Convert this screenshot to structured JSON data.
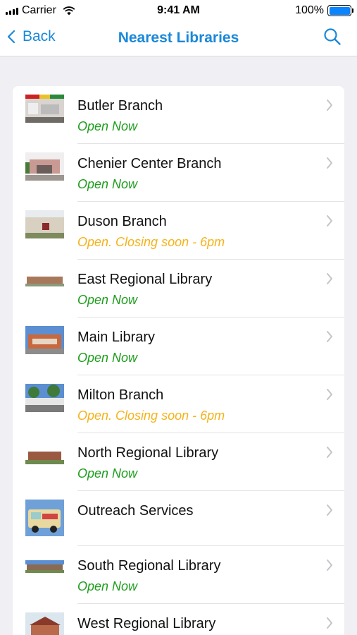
{
  "status_bar": {
    "carrier": "Carrier",
    "time": "9:41 AM",
    "battery": "100%",
    "battery_level": 1.0
  },
  "nav": {
    "back_label": "Back",
    "title": "Nearest Libraries",
    "search_icon": "search-icon"
  },
  "colors": {
    "accent": "#1a88d9",
    "open": "#1e9e1e",
    "closing": "#f5b21a"
  },
  "libraries": [
    {
      "name": "Butler Branch",
      "status": "Open Now",
      "state": "open"
    },
    {
      "name": "Chenier Center Branch",
      "status": "Open Now",
      "state": "open"
    },
    {
      "name": "Duson Branch",
      "status": "Open. Closing soon - 6pm",
      "state": "closing"
    },
    {
      "name": "East Regional Library",
      "status": "Open Now",
      "state": "open"
    },
    {
      "name": "Main Library",
      "status": "Open Now",
      "state": "open"
    },
    {
      "name": "Milton Branch",
      "status": "Open. Closing soon - 6pm",
      "state": "closing"
    },
    {
      "name": "North Regional Library",
      "status": "Open Now",
      "state": "open"
    },
    {
      "name": "Outreach Services",
      "status": "",
      "state": "none"
    },
    {
      "name": "South Regional Library",
      "status": "Open Now",
      "state": "open"
    },
    {
      "name": "West Regional Library",
      "status": "",
      "state": "open"
    }
  ]
}
